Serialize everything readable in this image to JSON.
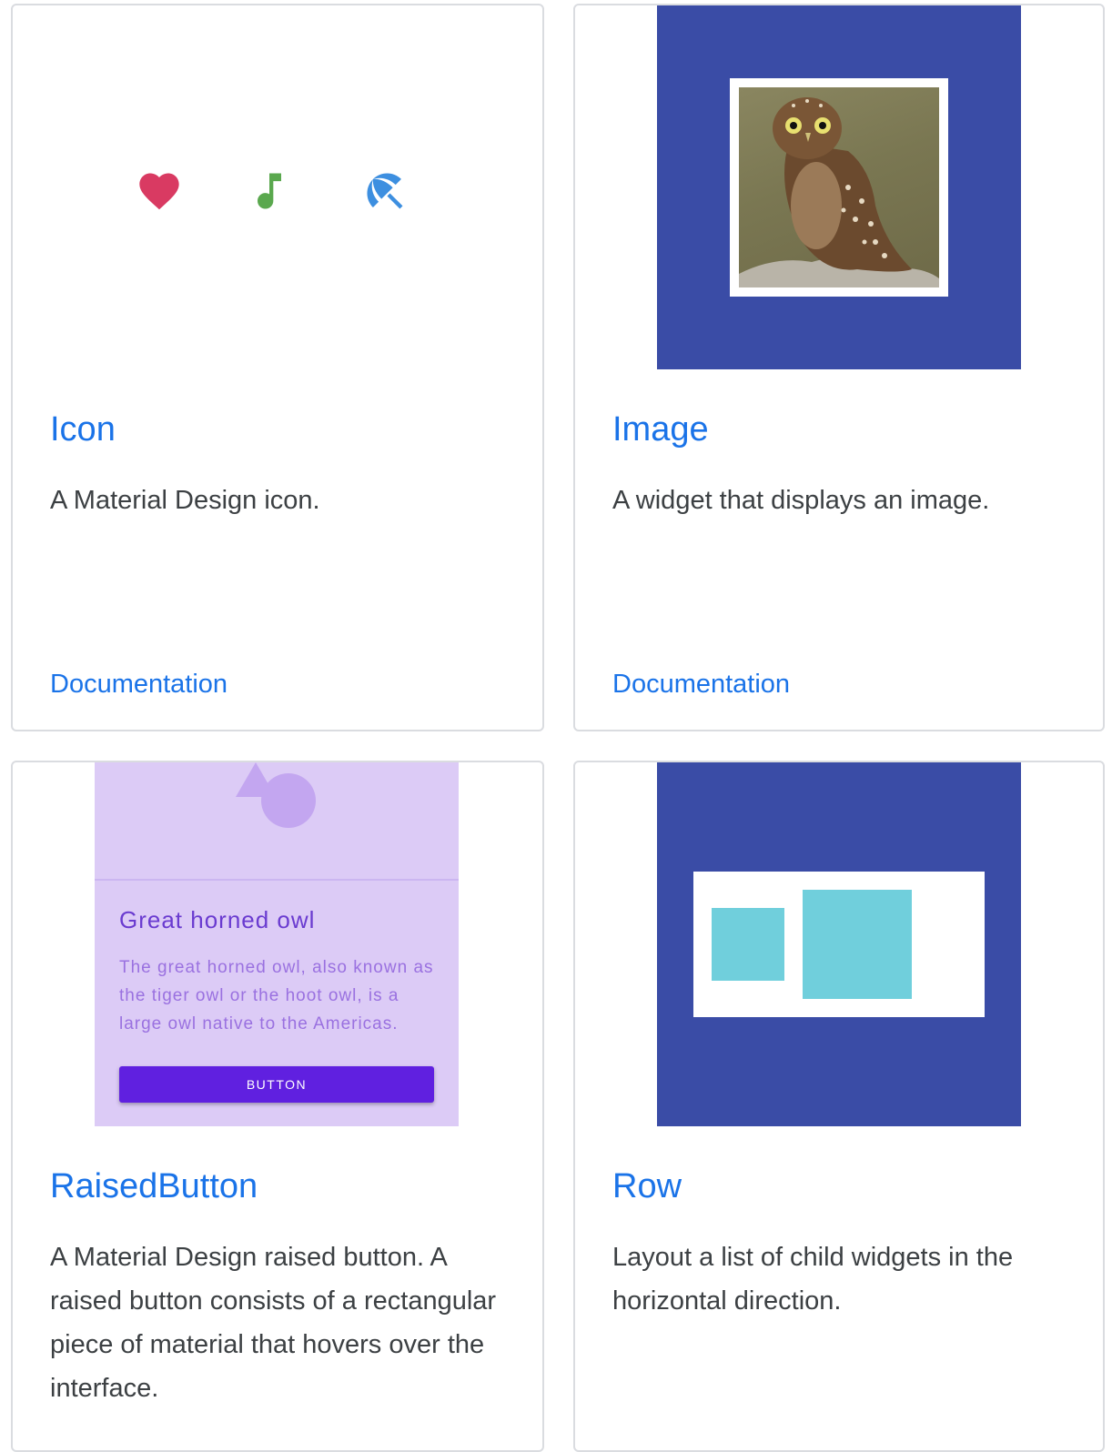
{
  "cards": [
    {
      "title": "Icon",
      "description": "A Material Design icon.",
      "link": "Documentation",
      "preview": {
        "icons": [
          {
            "name": "heart-icon",
            "color": "#d93a62"
          },
          {
            "name": "music-note-icon",
            "color": "#5aa84e"
          },
          {
            "name": "beach-access-icon",
            "color": "#3d8fe0"
          }
        ]
      }
    },
    {
      "title": "Image",
      "description": "A widget that displays an image.",
      "link": "Documentation",
      "preview": {
        "background": "#3a4ca6",
        "image_subject": "owl photo"
      }
    },
    {
      "title": "RaisedButton",
      "description": "A Material Design raised button. A raised button consists of a rectangular piece of material that hovers over the interface.",
      "preview": {
        "background": "#dccbf6",
        "card_title": "Great horned owl",
        "card_text": "The great horned owl, also known as the tiger owl or the hoot owl, is a large owl native to the Americas.",
        "button_label": "BUTTON",
        "button_color": "#6020e0"
      }
    },
    {
      "title": "Row",
      "description": "Layout a list of child widgets in the horizontal direction.",
      "preview": {
        "background": "#3a4ca6",
        "box_color": "#70cfdc"
      }
    }
  ]
}
